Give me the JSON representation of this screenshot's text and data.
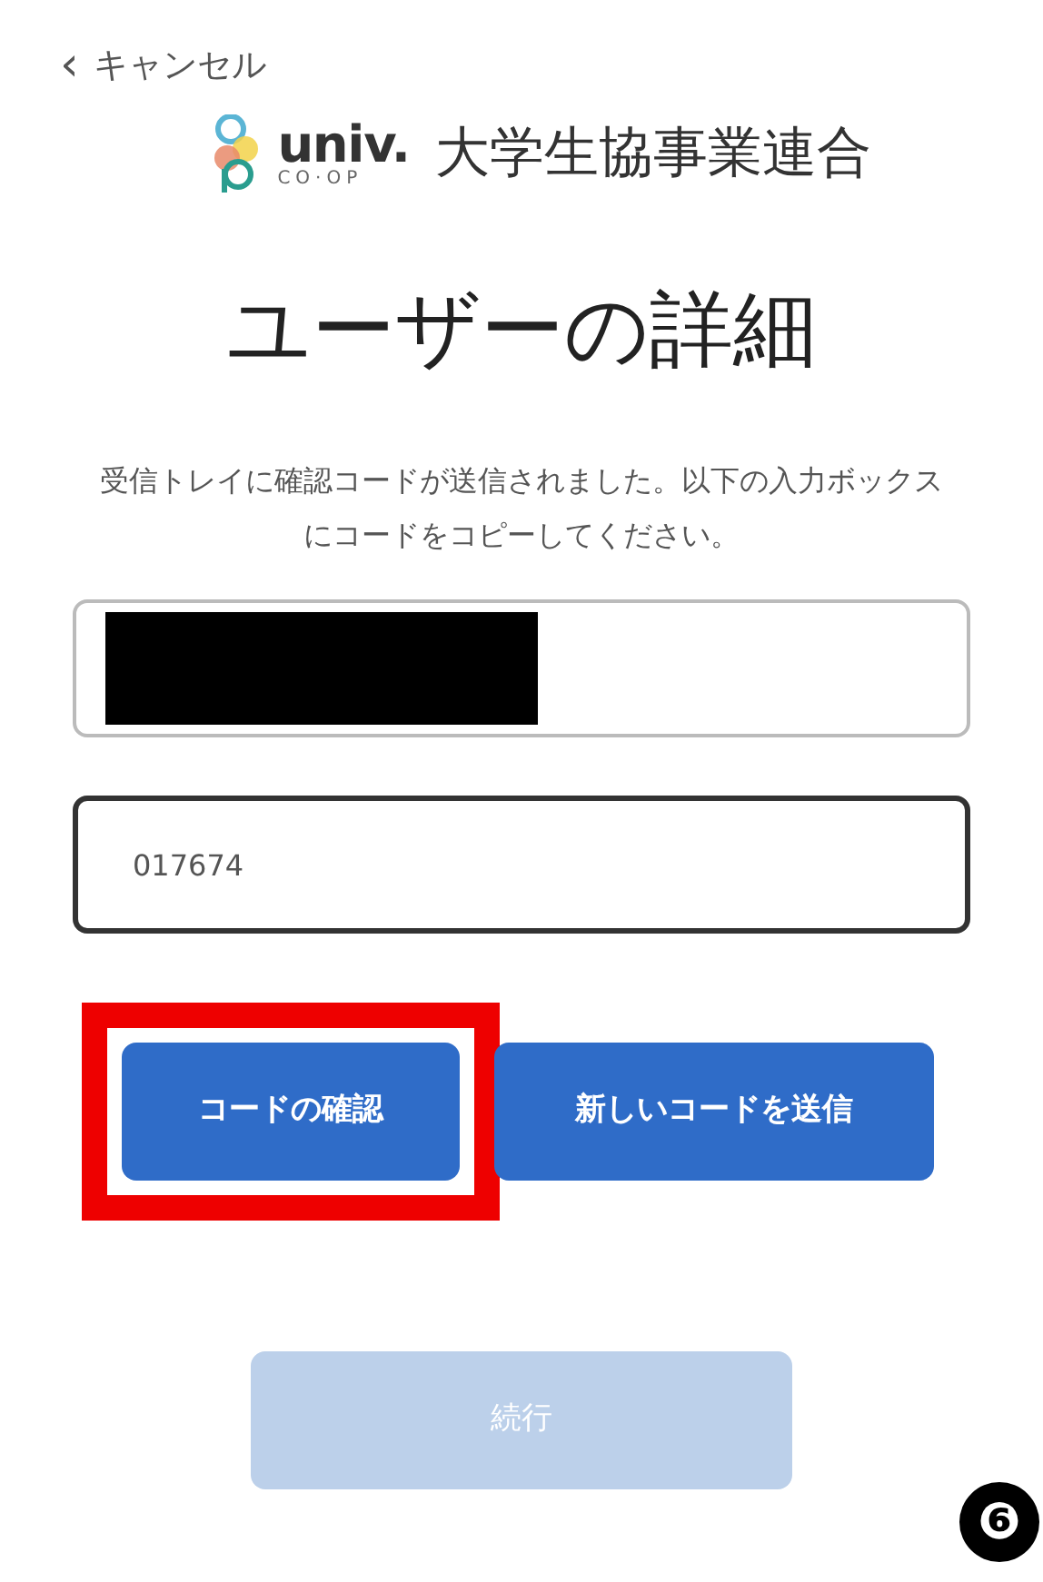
{
  "cancel_link": {
    "icon": "‹",
    "label": "キャンセル"
  },
  "logo": {
    "wordmark": "univ.",
    "subword": "CO·OP",
    "organization": "大学生協事業連合"
  },
  "heading": "ユーザーの詳細",
  "instructions": "受信トレイに確認コードが送信されました。以下の入力ボックスにコードをコピーしてください。",
  "fields": [
    {
      "kind": "redacted",
      "focused": false
    },
    {
      "kind": "text",
      "value": "017674",
      "focused": true
    }
  ],
  "buttons": [
    {
      "label": "コードの確認",
      "highlighted": true
    },
    {
      "label": "新しいコードを送信",
      "highlighted": false
    }
  ],
  "continue_button": {
    "label": "続行",
    "disabled": true
  },
  "step_marker": "❻"
}
